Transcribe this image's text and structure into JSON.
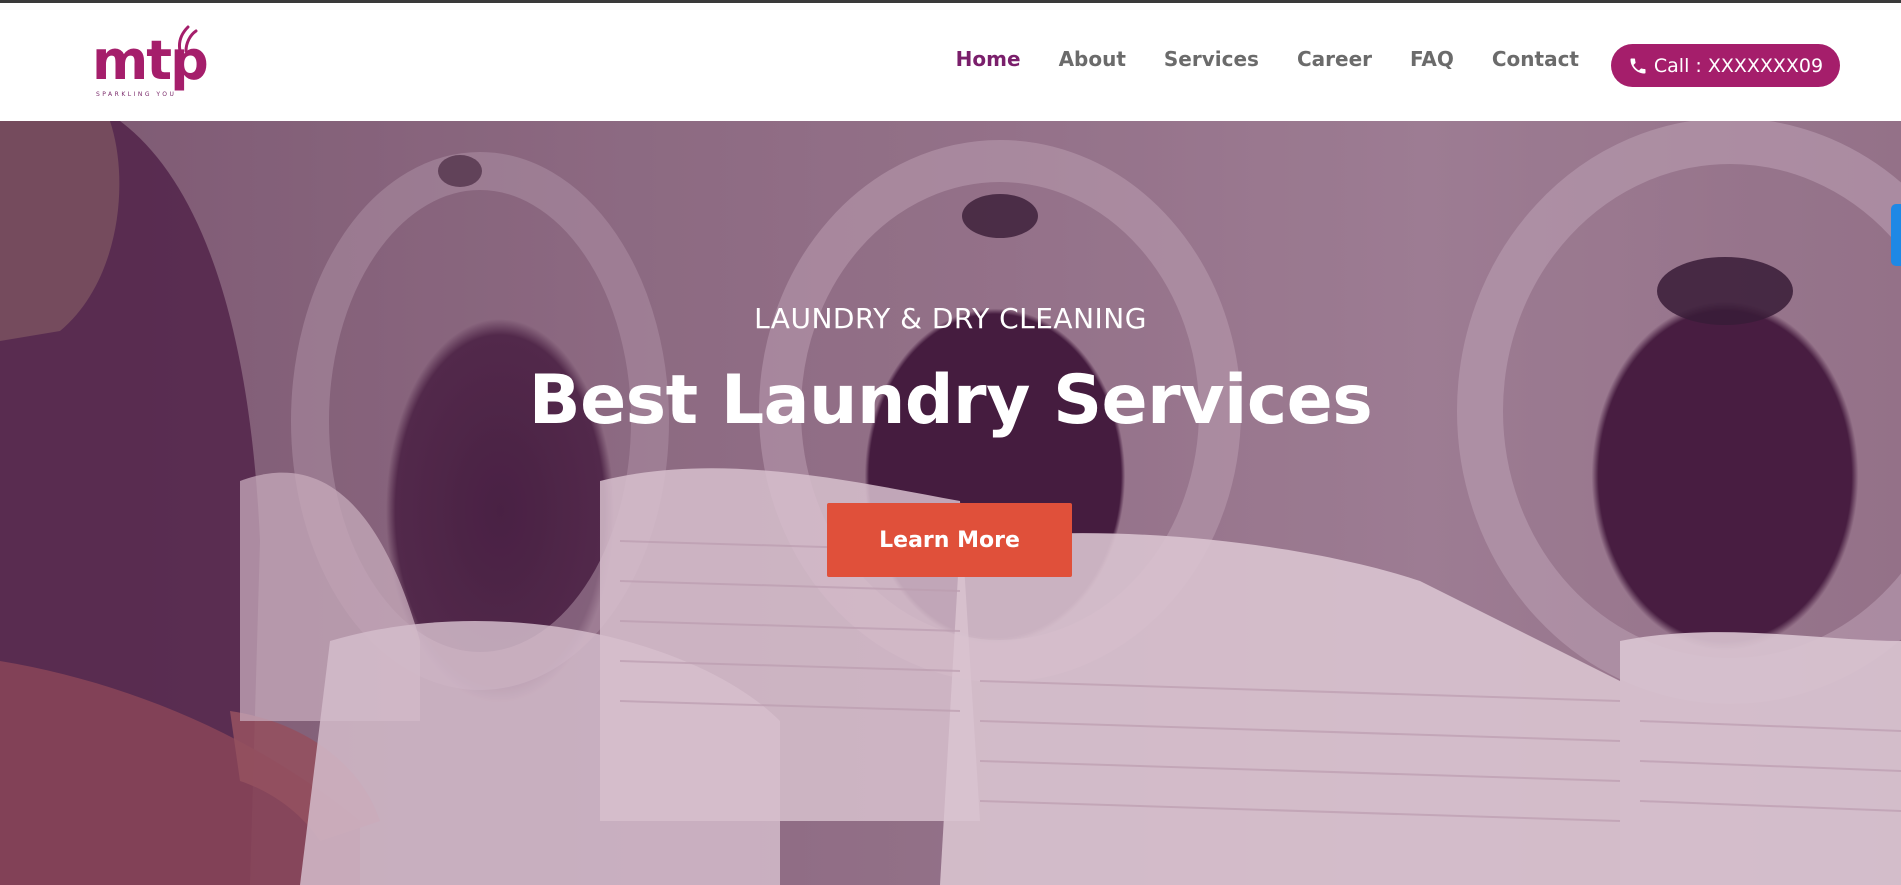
{
  "header": {
    "logo": {
      "text": "mtp",
      "tagline": "SPARKLING YOU"
    },
    "nav": [
      {
        "label": "Home",
        "active": true
      },
      {
        "label": "About",
        "active": false
      },
      {
        "label": "Services",
        "active": false
      },
      {
        "label": "Career",
        "active": false
      },
      {
        "label": "FAQ",
        "active": false
      },
      {
        "label": "Contact",
        "active": false
      }
    ],
    "call_button": {
      "label": "Call : XXXXXXX09",
      "icon": "phone-icon"
    }
  },
  "hero": {
    "subtitle": "LAUNDRY & DRY CLEANING",
    "title": "Best Laundry Services",
    "cta_label": "Learn More"
  },
  "colors": {
    "brand": "#a51e6b",
    "nav_active": "#7a1f6b",
    "nav_text": "#6b6b6b",
    "cta": "#e0503a",
    "scroll_indicator": "#1e88e5"
  }
}
